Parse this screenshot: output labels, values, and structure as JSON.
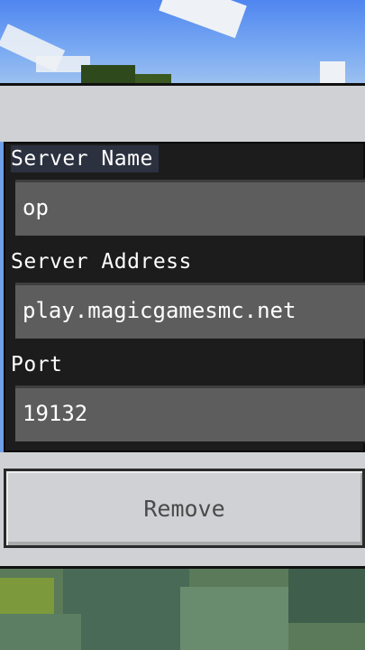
{
  "form": {
    "server_name_label": "Server Name",
    "server_name_value": "op",
    "server_address_label": "Server Address",
    "server_address_value": "play.magicgamesmc.net",
    "port_label": "Port",
    "port_value": "19132"
  },
  "actions": {
    "remove_label": "Remove"
  },
  "colors": {
    "panel_background": "#d0d1d4",
    "form_background": "#1c1c1c",
    "field_background": "#5d5d5e",
    "label_text": "#ffffff",
    "button_text": "#4a4a4a"
  }
}
